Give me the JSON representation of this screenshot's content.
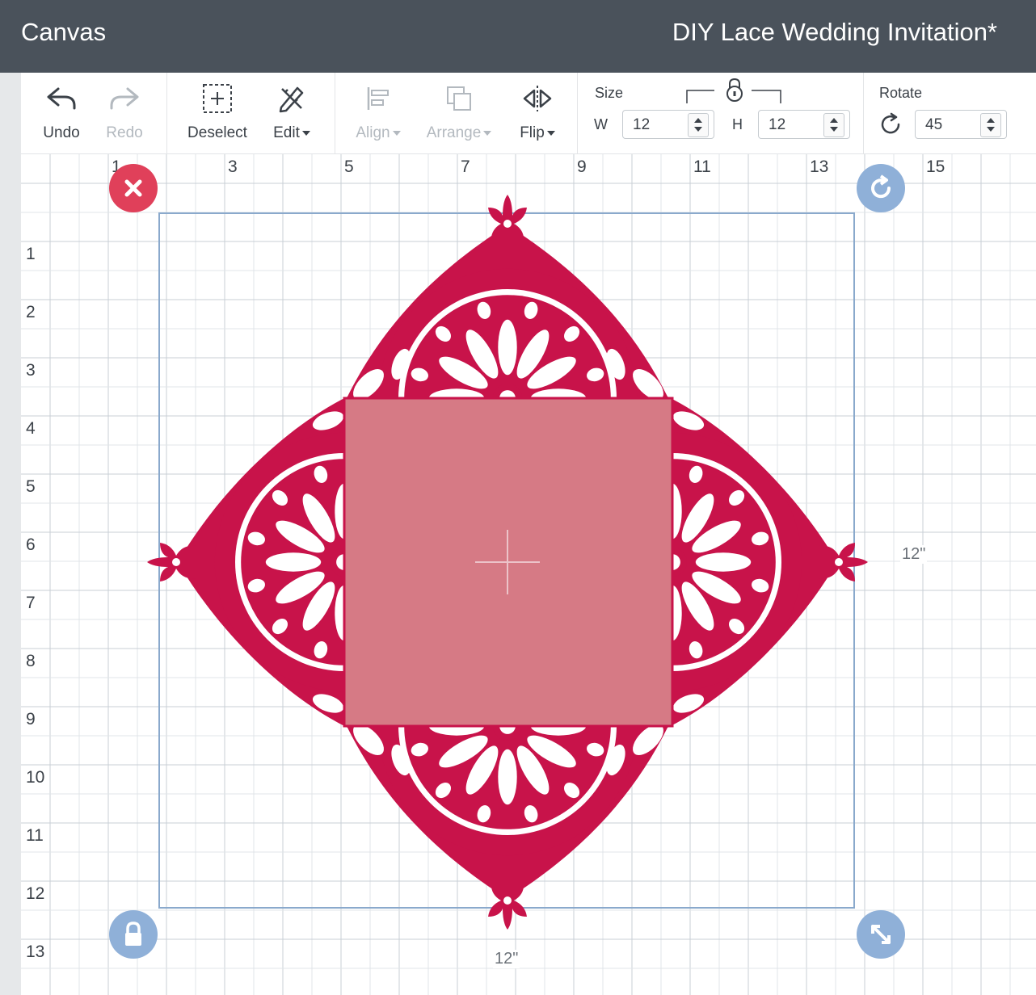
{
  "header": {
    "app_title": "Canvas",
    "project_title": "DIY Lace Wedding Invitation*"
  },
  "toolbar": {
    "undo_label": "Undo",
    "redo_label": "Redo",
    "deselect_label": "Deselect",
    "edit_label": "Edit",
    "align_label": "Align",
    "arrange_label": "Arrange",
    "flip_label": "Flip",
    "size_label": "Size",
    "w_label": "W",
    "h_label": "H",
    "width_value": "12",
    "height_value": "12",
    "rotate_label": "Rotate",
    "rotate_value": "45"
  },
  "rulers": {
    "horizontal": [
      "1",
      "3",
      "5",
      "7",
      "9",
      "11",
      "13",
      "15"
    ],
    "vertical": [
      "1",
      "2",
      "3",
      "4",
      "5",
      "6",
      "7",
      "8",
      "9",
      "10",
      "11",
      "12",
      "13"
    ]
  },
  "selection": {
    "width_label": "12\"",
    "height_label": "12\""
  },
  "colors": {
    "header": "#4a525b",
    "lace": "#c8134a",
    "square": "#d67a85",
    "selection_box": "#8aa9cc",
    "delete_handle": "#e0405a",
    "handle": "#8fb0d8",
    "grid_line": "#d9dde2"
  },
  "icons": {
    "undo": "undo-arrow-icon",
    "redo": "redo-arrow-icon",
    "deselect": "deselect-box-icon",
    "edit": "pencil-ruler-icon",
    "align": "align-icon",
    "arrange": "arrange-icon",
    "flip": "flip-icon",
    "lock": "padlock-icon",
    "rotate": "rotate-arrow-icon"
  }
}
